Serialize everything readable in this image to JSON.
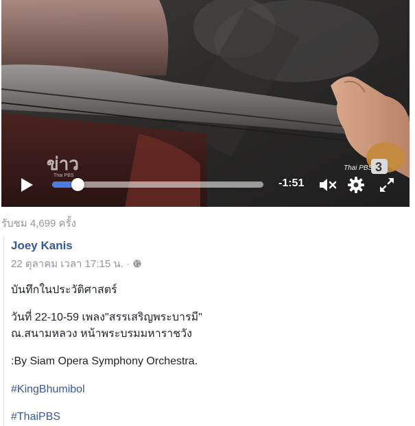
{
  "video": {
    "watermark_left": "ข่าว",
    "watermark_left_sub": "Thai PBS",
    "watermark_right": "Thai PBS",
    "watermark_channel": "3",
    "time_remaining": "-1:51",
    "progress_fraction": 0.12,
    "icons": {
      "play": "play-icon",
      "mute": "mute-icon",
      "settings": "gear-icon",
      "fullscreen": "fullscreen-icon"
    }
  },
  "views_text": "รับชม 4,699 ครั้ง",
  "post": {
    "author": "Joey Kanis",
    "timestamp": "22 ตุลาคม เวลา 17:15 น.",
    "separator": "·",
    "privacy_icon": "globe-icon",
    "line1": "บันทึกในประวัติศาสตร์",
    "line2": "วันที่ 22-10-59 เพลง\"สรรเสริญพระบารมี\"",
    "line3": "ณ.สนามหลวง หน้าพระบรมมหาราชวัง",
    "line4": ":By Siam Opera Symphony Orchestra.",
    "hashtag1": "#KingBhumibol",
    "hashtag2": "#ThaiPBS"
  },
  "colors": {
    "link": "#365899",
    "muted": "#90949c",
    "seek_fill": "#4a7de2"
  }
}
